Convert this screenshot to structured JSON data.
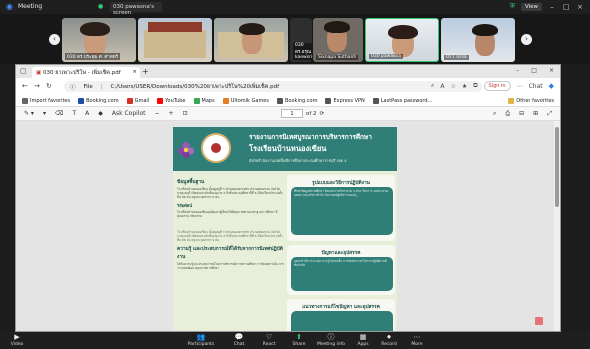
{
  "meeting": {
    "title": "Meeting",
    "share_tab": "030 pawasna's screen",
    "view_label": "View"
  },
  "participants": [
    {
      "name": "030 ดร.ประทุม ศ. ศาสตร์"
    },
    {
      "name": ""
    },
    {
      "name": ""
    },
    {
      "name": "030 ดร.อรุณ kaewsri..."
    },
    {
      "name": "Sixnapa Suthanh"
    },
    {
      "name": "030 pawasna"
    },
    {
      "name": "OTT Ursa"
    }
  ],
  "browser": {
    "tab_title": "030 ยาเพาะปริโษ - เพิ่มเช็ค.pdf",
    "url_label": "File",
    "url": "C:/Users/USER/Downloads/030%20ยาเพาะปริโษ%20เพิ่มเช็ค.pdf",
    "signin": "Sign in",
    "chat": "Chat",
    "favorites": [
      "Import favorites",
      "Booking.com",
      "Gmail",
      "YouTube",
      "Maps",
      "Ultomik Games",
      "Booking.com",
      "Express VPN",
      "LastPass password..."
    ],
    "other_favorites": "Other favorites"
  },
  "pdf_toolbar": {
    "ask_copilot": "Ask Copilot",
    "page_current": "1",
    "page_total": "of 2"
  },
  "poster": {
    "title1": "รายงานการนิเทศบูรณาการบริหารการศึกษา",
    "title2": "โรงเรียนบ้านหนองเขียน",
    "subtitle": "สังกัดสำนักงานเขตพื้นที่การศึกษาประถมศึกษาราชบุรี เขต 4",
    "sec_basic": "ข้อมูลพื้นฐาน",
    "basic_text": "โรงเรียนบ้านหนองเขียน ตั้งอยู่หมู่ที่ 3 ตำบลดอนตาเพชร อำเภอพนมทวน จังหวัดกาญจนบุรี เปิดสอนระดับชั้นอนุบาล 2 ถึงชั้นประถมศึกษาปีที่ 6 มีนักเรียนจำนวนทั้งสิ้น 86 คน ครูและบุคลากร 9 คน",
    "vision_label": "วิสัยทัศน์",
    "vision_text": "โรงเรียนบ้านหนองเขียนมุ่งพัฒนาผู้เรียนให้มีคุณภาพตามมาตรฐานการศึกษา มีคุณธรรม จริยธรรม",
    "sec_importance": "ความรู้ และประสบการณ์ที่ได้รับจากการนิเทศปฏิบัติงาน",
    "importance_text": "ได้รับความรู้และประสบการณ์ในการบริหารจัดการสถานศึกษา การนิเทศภายใน การวางแผนพัฒนาคุณภาพการศึกษา",
    "sec_model": "รูปแบบและวิธีการปฏิบัติงาน",
    "model_text": "ศึกษาข้อมูลสถานศึกษา สังเกตการบริหารงาน 4 ฝ่าย วิชาการ งบประมาณ บุคคล และบริหารทั่วไป สัมภาษณ์ผู้บริหารและครู",
    "sec_problem": "ปัญหาและอุปสรรค",
    "problem_text": "บุคลากรมีภาระงานมาก ครูไม่ครบชั้น การจัดสรรเวลาในการปฏิบัติงานมีข้อจำกัด",
    "sec_guide": "แนวทางการแก้ไขปัญหา และอุปสรรค"
  },
  "bottom_bar": [
    {
      "icon": "video-icon",
      "label": "Video"
    },
    {
      "icon": "participants-icon",
      "label": "Participants"
    },
    {
      "icon": "chat-icon",
      "label": "Chat"
    },
    {
      "icon": "react-icon",
      "label": "React"
    },
    {
      "icon": "share-icon",
      "label": "Share"
    },
    {
      "icon": "info-icon",
      "label": "Meeting info"
    },
    {
      "icon": "apps-icon",
      "label": "Apps"
    },
    {
      "icon": "record-icon",
      "label": "Record"
    },
    {
      "icon": "more-icon",
      "label": "More"
    }
  ],
  "colors": {
    "poster_teal": "#2f7f78",
    "share_green": "#2ecc71"
  }
}
